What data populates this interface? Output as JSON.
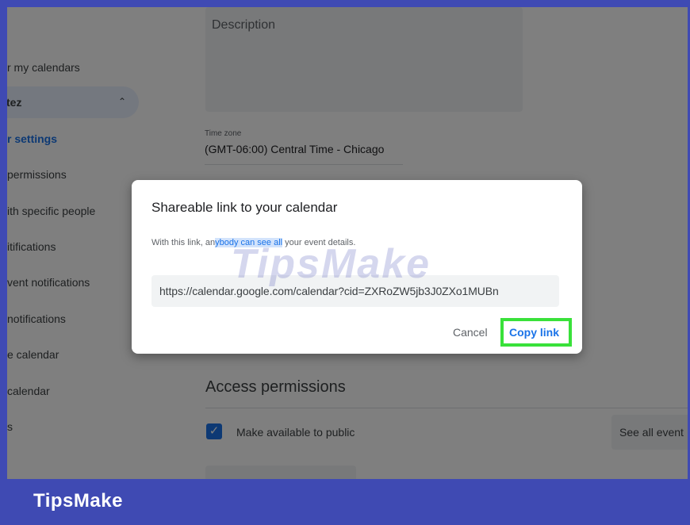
{
  "sidebar": {
    "items": [
      {
        "label": "r my calendars"
      },
      {
        "label": "ortez"
      },
      {
        "label": "r settings"
      },
      {
        "label": "permissions"
      },
      {
        "label": "ith specific people"
      },
      {
        "label": "itifications"
      },
      {
        "label": "vent notifications"
      },
      {
        "label": "notifications"
      },
      {
        "label": "e calendar"
      },
      {
        "label": "calendar"
      },
      {
        "label": "s"
      }
    ]
  },
  "settings": {
    "description_placeholder": "Description",
    "timezone_label": "Time zone",
    "timezone_value": "(GMT-06:00) Central Time - Chicago",
    "access_title": "Access permissions",
    "public_label": "Make available to public",
    "public_checked": true,
    "see_all_label": "See all event"
  },
  "dialog": {
    "title": "Shareable link to your calendar",
    "body_prefix": "With this link, an",
    "body_highlight": "ybody can see all",
    "body_suffix": " your event details.",
    "link_value": "https://calendar.google.com/calendar?cid=ZXRoZW5jb3J0ZXo1MUBn",
    "cancel_label": "Cancel",
    "copy_label": "Copy link"
  },
  "watermark": "TipsMake",
  "footer": {
    "brand": "TipsMake"
  },
  "colors": {
    "frame": "#3f4ab3",
    "accent": "#1a73e8",
    "highlight_box": "#39e13a"
  }
}
